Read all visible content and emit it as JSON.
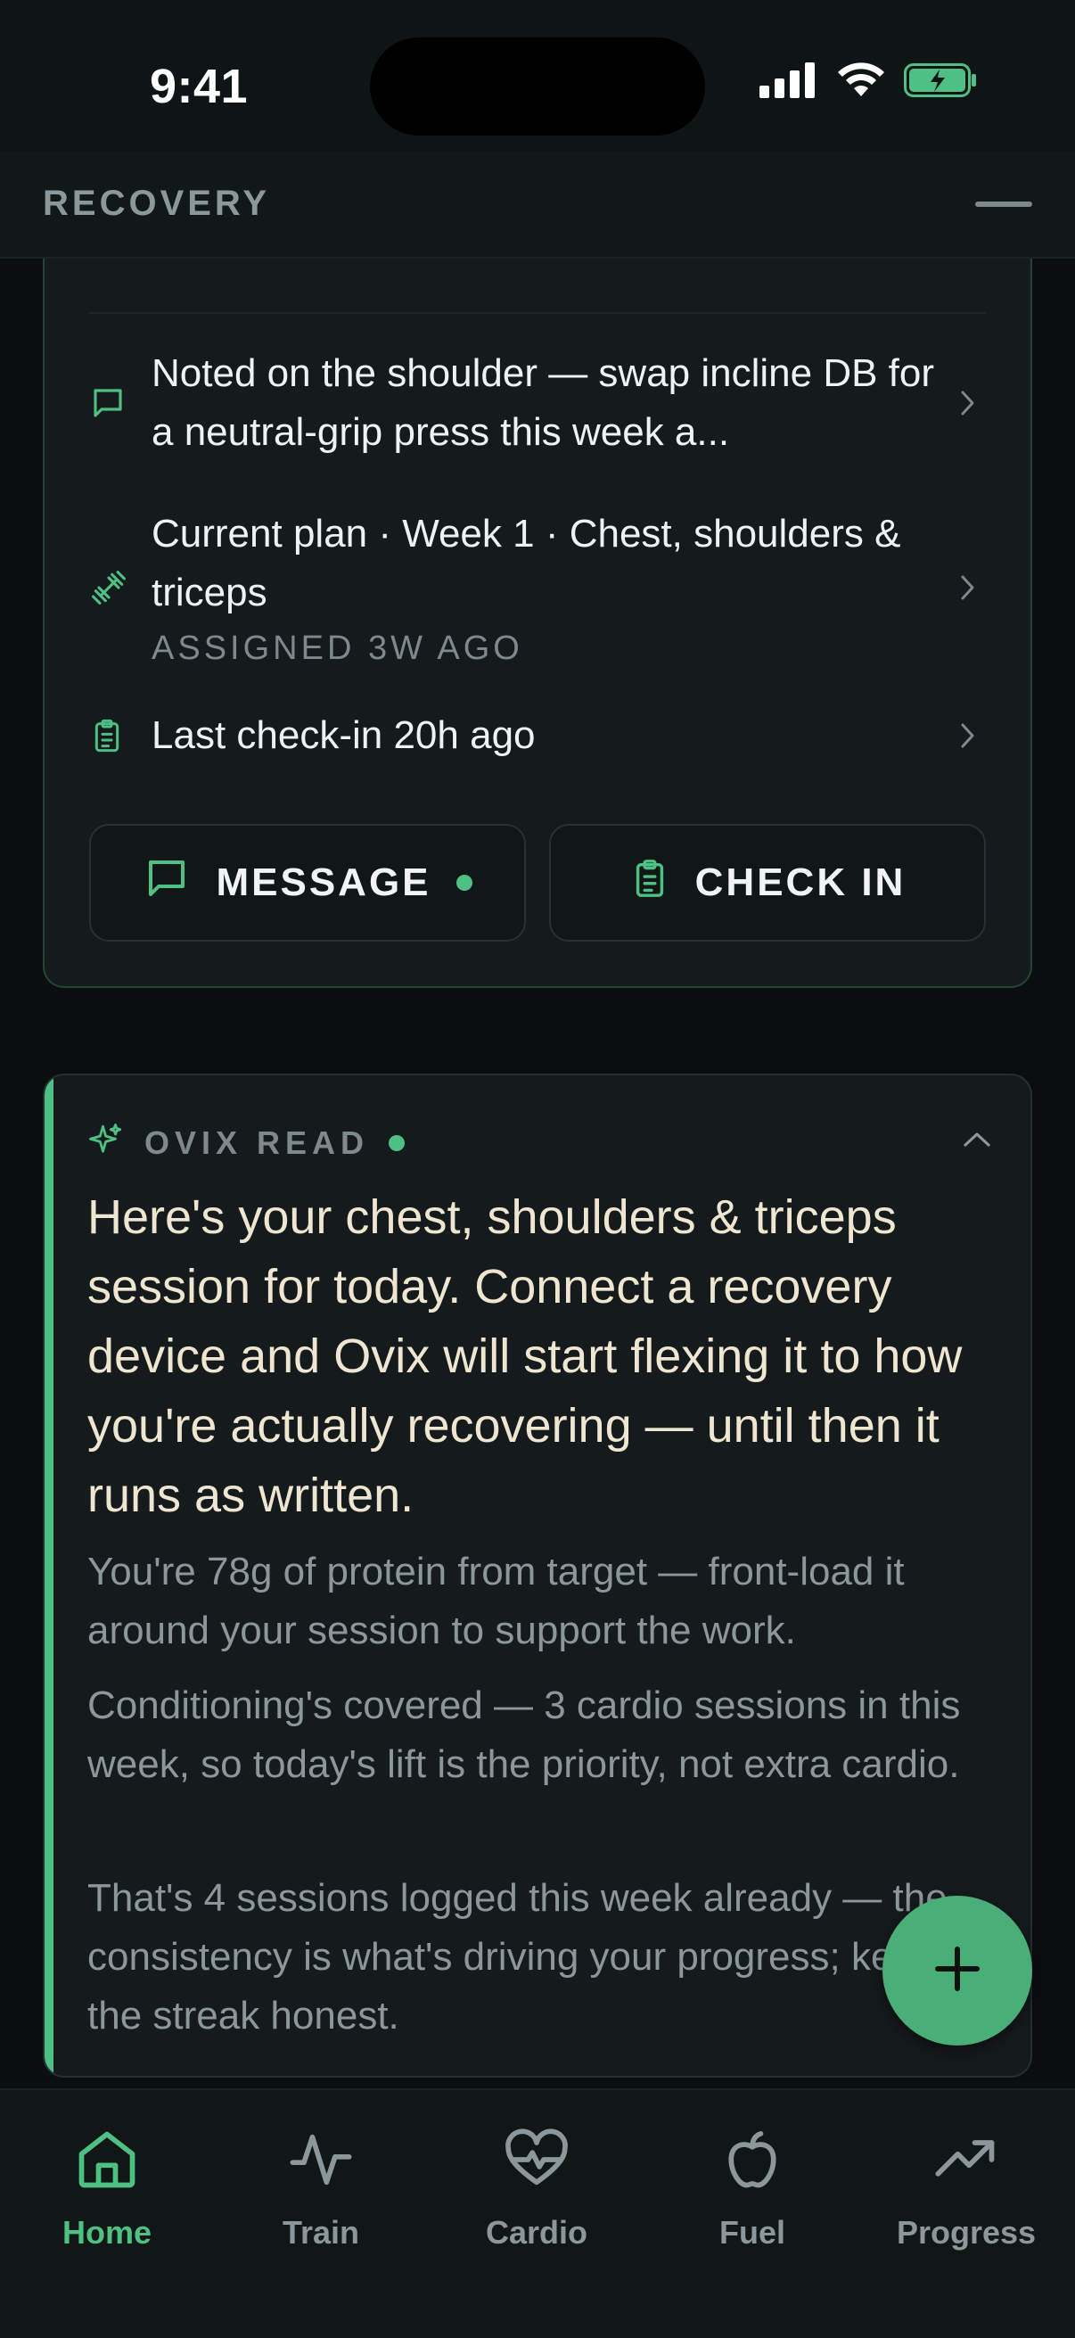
{
  "status_bar": {
    "time": "9:41"
  },
  "section": {
    "title": "RECOVERY"
  },
  "coach": {
    "rows": [
      {
        "icon": "message-icon",
        "text": "Noted on the shoulder — swap incline DB for a neutral-grip press this week a..."
      },
      {
        "icon": "dumbbell-icon",
        "text": "Current plan · Week 1 · Chest, shoulders & triceps",
        "sub": "ASSIGNED 3W AGO"
      },
      {
        "icon": "clipboard-icon",
        "text": "Last check-in 20h ago"
      }
    ],
    "message_label": "MESSAGE",
    "checkin_label": "CHECK IN"
  },
  "ovix": {
    "label": "OVIX READ",
    "main": "Here's your chest, shoulders & triceps session for today. Connect a recovery device and Ovix will start flexing it to how you're actually recovering — until then it runs as written.",
    "paragraphs": [
      "You're 78g of protein from target — front-load it around your session to support the work.",
      "Conditioning's covered — 3 cardio sessions in this week, so today's lift is the priority, not extra cardio.",
      "That's 4 sessions logged this week already — the consistency is what's driving your progress; keep the streak honest."
    ]
  },
  "nav": {
    "items": [
      {
        "label": "Home",
        "icon": "home-icon",
        "active": true
      },
      {
        "label": "Train",
        "icon": "pulse-icon",
        "active": false
      },
      {
        "label": "Cardio",
        "icon": "heart-icon",
        "active": false
      },
      {
        "label": "Fuel",
        "icon": "apple-icon",
        "active": false
      },
      {
        "label": "Progress",
        "icon": "trend-up-icon",
        "active": false
      }
    ]
  },
  "colors": {
    "accent": "#4ec083",
    "background": "#0b0e0f",
    "card": "#151a1c",
    "headline": "#efe6d2",
    "muted": "#8b979a"
  }
}
